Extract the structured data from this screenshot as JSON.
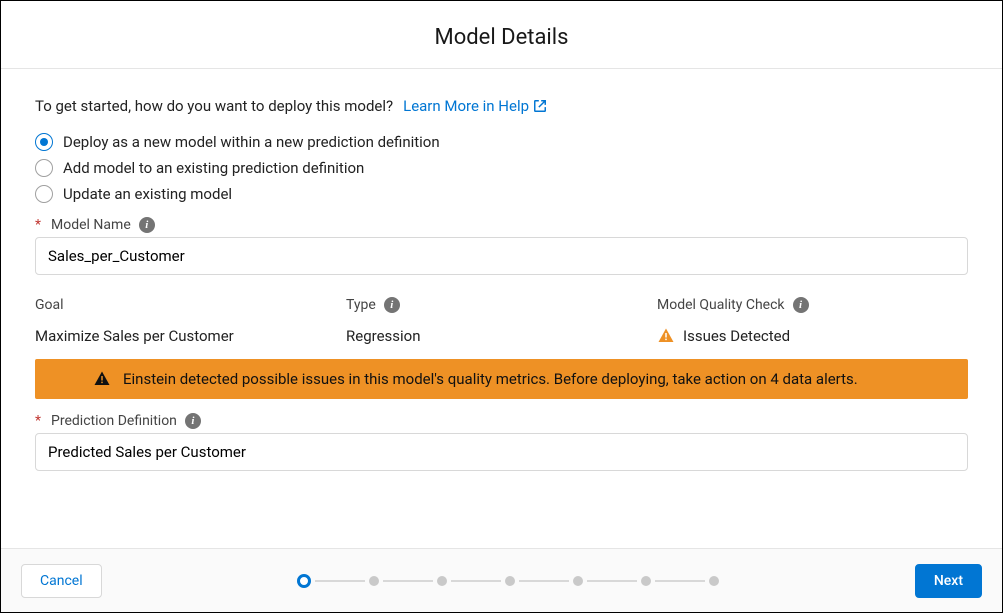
{
  "header": {
    "title": "Model Details"
  },
  "prompt": {
    "text": "To get started, how do you want to deploy this model?",
    "learn_more": "Learn More in Help"
  },
  "deploy_options": {
    "opt1": "Deploy as a new model within a new prediction definition",
    "opt2": "Add model to an existing prediction definition",
    "opt3": "Update an existing model",
    "selected": "opt1"
  },
  "model_name": {
    "label": "Model Name",
    "value": "Sales_per_Customer"
  },
  "goal": {
    "label": "Goal",
    "value": "Maximize Sales per Customer"
  },
  "type": {
    "label": "Type",
    "value": "Regression"
  },
  "quality": {
    "label": "Model Quality Check",
    "value": "Issues Detected"
  },
  "alert": {
    "message": "Einstein detected possible issues in this model's quality metrics. Before deploying, take action on 4 data alerts."
  },
  "prediction_definition": {
    "label": "Prediction Definition",
    "value": "Predicted Sales per Customer"
  },
  "footer": {
    "cancel": "Cancel",
    "next": "Next",
    "steps_total": 7,
    "active_step": 1
  }
}
